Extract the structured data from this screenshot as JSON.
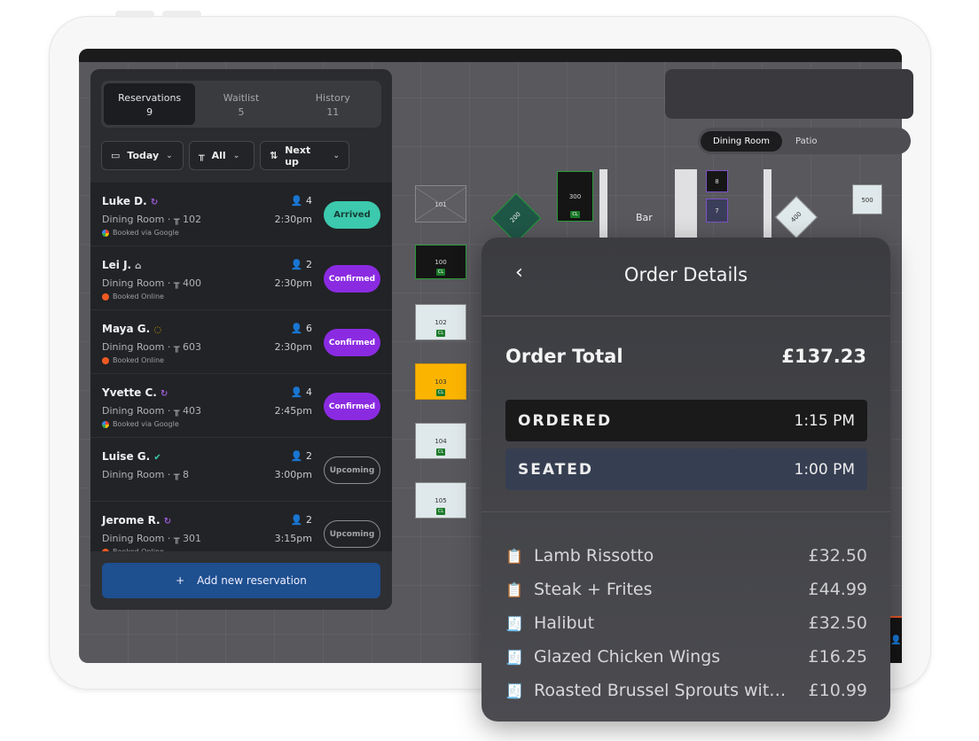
{
  "reservations_panel": {
    "tabs": [
      {
        "label": "Reservations",
        "count": "9"
      },
      {
        "label": "Waitlist",
        "count": "5"
      },
      {
        "label": "History",
        "count": "11"
      }
    ],
    "filters": [
      {
        "label": "Today",
        "icon": "calendar-icon"
      },
      {
        "label": "All",
        "icon": "table-icon"
      },
      {
        "label": "Next up",
        "icon": "sort-icon"
      }
    ],
    "rows": [
      {
        "name": "Luke D.",
        "area": "Dining Room ·",
        "table": "102",
        "party": "4",
        "time": "2:30pm",
        "source": "Booked via Google",
        "status": "Arrived",
        "tag_icon": "recurring-icon"
      },
      {
        "name": "Lei J.",
        "area": "Dining Room ·",
        "table": "400",
        "party": "2",
        "time": "2:30pm",
        "source": "Booked Online",
        "status": "Confirmed",
        "tag_icon": "birthday-cake-icon"
      },
      {
        "name": "Maya G.",
        "area": "Dining Room ·",
        "table": "603",
        "party": "6",
        "time": "2:30pm",
        "source": "Booked Online",
        "status": "Confirmed",
        "tag_icon": "message-icon"
      },
      {
        "name": "Yvette C.",
        "area": "Dining Room ·",
        "table": "403",
        "party": "4",
        "time": "2:45pm",
        "source": "Booked via Google",
        "status": "Confirmed",
        "tag_icon": "recurring-icon"
      },
      {
        "name": "Luise G.",
        "area": "Dining Room ·",
        "table": "8",
        "party": "2",
        "time": "3:00pm",
        "source": "",
        "status": "Upcoming",
        "tag_icon": "verified-icon"
      },
      {
        "name": "Jerome R.",
        "area": "Dining Room ·",
        "table": "301",
        "party": "2",
        "time": "3:15pm",
        "source": "Booked Online",
        "status": "Upcoming",
        "tag_icon": "recurring-icon"
      }
    ],
    "add_button": "Add new reservation",
    "status_colors": {
      "Arrived": "#3cc9ad",
      "Confirmed": "#8a2be2",
      "Upcoming": "#8c8d91"
    }
  },
  "floor": {
    "room_tabs": [
      "Dining Room",
      "Patio"
    ],
    "bar_label": "Bar",
    "tables": [
      "101",
      "200",
      "300",
      "100",
      "102",
      "103",
      "104",
      "105",
      "8",
      "7",
      "400",
      "500"
    ],
    "cl_tag": "CL"
  },
  "order_details": {
    "title": "Order Details",
    "total_label": "Order Total",
    "total": "£137.23",
    "ordered_label": "ORDERED",
    "ordered_time": "1:15 PM",
    "seated_label": "SEATED",
    "seated_time": "1:00 PM",
    "items": [
      {
        "name": "Lamb Rissotto",
        "price": "£32.50",
        "state": "sent"
      },
      {
        "name": "Steak + Frites",
        "price": "£44.99",
        "state": "sent"
      },
      {
        "name": "Halibut",
        "price": "£32.50",
        "state": "served"
      },
      {
        "name": "Glazed Chicken Wings",
        "price": "£16.25",
        "state": "served"
      },
      {
        "name": "Roasted Brussel Sprouts with Bacon",
        "price": "£10.99",
        "state": "served"
      }
    ]
  }
}
